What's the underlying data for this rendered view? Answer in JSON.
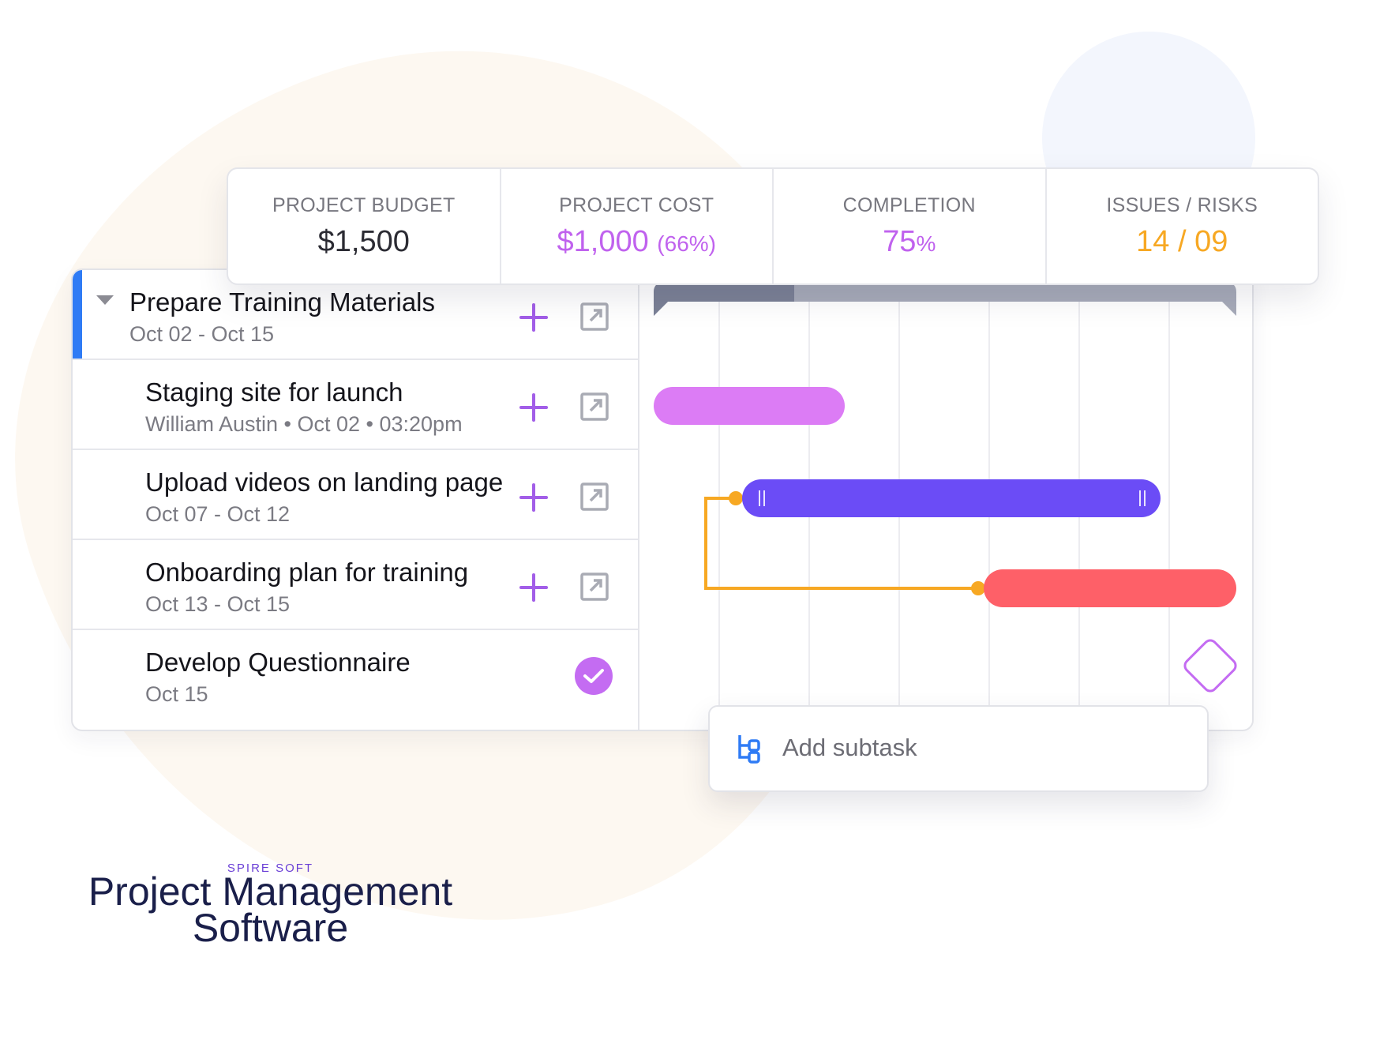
{
  "stats": [
    {
      "label": "PROJECT BUDGET",
      "value": "$1,500",
      "extra": ""
    },
    {
      "label": "PROJECT COST",
      "value": "$1,000",
      "extra": "(66%)"
    },
    {
      "label": "COMPLETION",
      "value": "75",
      "extra": "%"
    },
    {
      "label": "ISSUES / RISKS",
      "value": "14 / 09",
      "extra": ""
    }
  ],
  "tasks": [
    {
      "title": "Prepare Training Materials",
      "subtitle": "Oct 02 - Oct 15"
    },
    {
      "title": "Staging site for launch",
      "subtitle": "William Austin • Oct 02 • 03:20pm"
    },
    {
      "title": "Upload videos on landing page",
      "subtitle": "Oct 07 - Oct 12"
    },
    {
      "title": "Onboarding plan for training",
      "subtitle": "Oct 13 - Oct 15"
    },
    {
      "title": "Develop Questionnaire",
      "subtitle": "Oct 15"
    }
  ],
  "subtask": {
    "label": "Add subtask"
  },
  "brand": {
    "company": "SPIRE SOFT",
    "line1": "Project Management",
    "line2": "Software"
  },
  "colors": {
    "accent": "#a25ee8",
    "summary_progress": "#7b8196",
    "summary_remaining": "#a7abb9",
    "bar_staging": "#dc7cf5",
    "bar_upload": "#6b4cf6",
    "bar_onboarding": "#fe6068",
    "dependency": "#f7a823",
    "milestone": "#c46cf2",
    "parent_marker": "#2f7bf5"
  }
}
